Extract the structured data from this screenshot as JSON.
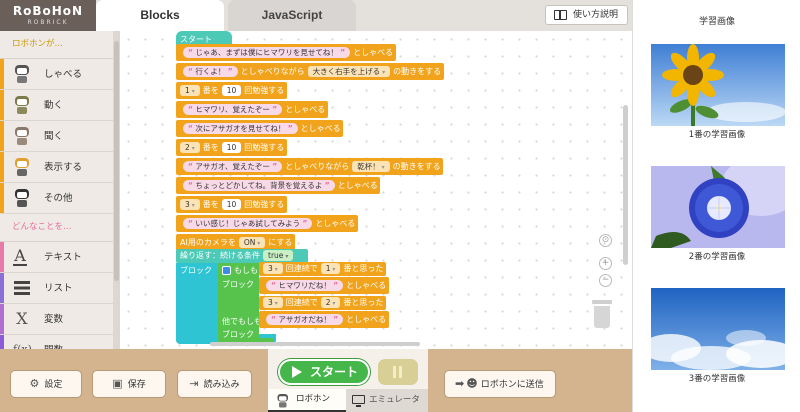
{
  "header": {
    "logo_top": "RoBoHoN",
    "logo_bottom": "ROBRICK",
    "tabs": [
      "Blocks",
      "JavaScript"
    ],
    "help_label": "使い方説明"
  },
  "categories": {
    "section1": "ロボホンが…",
    "items1": [
      "しゃべる",
      "動く",
      "聞く",
      "表示する",
      "その他"
    ],
    "section2": "どんなことを…",
    "items2": [
      "テキスト",
      "リスト",
      "変数",
      "関数"
    ],
    "colors": [
      "#f1a31c",
      "#f1a31c",
      "#f1a31c",
      "#f1a31c",
      "#f1a31c",
      "#e879a8",
      "#8a6fd8",
      "#b06fd0",
      "#8e5bd8"
    ]
  },
  "workspace": {
    "start_label": "スタート",
    "rows": [
      {
        "text": "じゃあ、まずは僕にヒマワリを見せてね！",
        "verb": "としゃべる"
      },
      {
        "text": "行くよ！",
        "mid": "としゃべりながら",
        "sel": "大きく右手を上げる",
        "verb": "の動きをする"
      },
      {
        "num_sel": "1",
        "label1": "番を",
        "num": "10",
        "verb": "回勉強する"
      },
      {
        "text": "ヒマワリ、覚えたぞー",
        "verb": "としゃべる"
      },
      {
        "text": "次にアサガオを見せてね！",
        "verb": "としゃべる"
      },
      {
        "num_sel": "2",
        "label1": "番を",
        "num": "10",
        "verb": "回勉強する"
      },
      {
        "text": "アサガオ、覚えたぞー",
        "mid": "としゃべりながら",
        "sel": "乾杯！",
        "verb": "の動きをする"
      },
      {
        "text": "ちょっとどかしてね。背景を覚えるよ",
        "verb": "としゃべる"
      },
      {
        "num_sel": "3",
        "label1": "番を",
        "num": "10",
        "verb": "回勉強する"
      },
      {
        "text": "いい感じ！じゃあ試してみよう",
        "verb": "としゃべる"
      }
    ],
    "camera": {
      "label1": "AI用のカメラを",
      "sel": "ON",
      "label2": "にする"
    },
    "loop": {
      "label": "繰り返す：続ける条件",
      "cond": "true",
      "block_label": "ブロック"
    },
    "if": {
      "label_if": "もしも",
      "num1": "3",
      "mid1": "回連続で",
      "num2": "1",
      "mid2": "番と思った",
      "block_label": "ブロック",
      "say1": "ヒマワリだね！",
      "verb": "としゃべる",
      "label_elif": "他でもしも",
      "num3": "3",
      "num4": "2",
      "say2": "アサガオだね！"
    }
  },
  "toolbar": {
    "settings": "設定",
    "save": "保存",
    "load": "読み込み",
    "start": "スタート",
    "mode_robohon": "ロボホン",
    "mode_emulator": "エミュレータ",
    "send": "ロボホンに送信"
  },
  "rightpanel": {
    "title": "学習画像",
    "captions": [
      "1番の学習画像",
      "2番の学習画像",
      "3番の学習画像"
    ]
  }
}
